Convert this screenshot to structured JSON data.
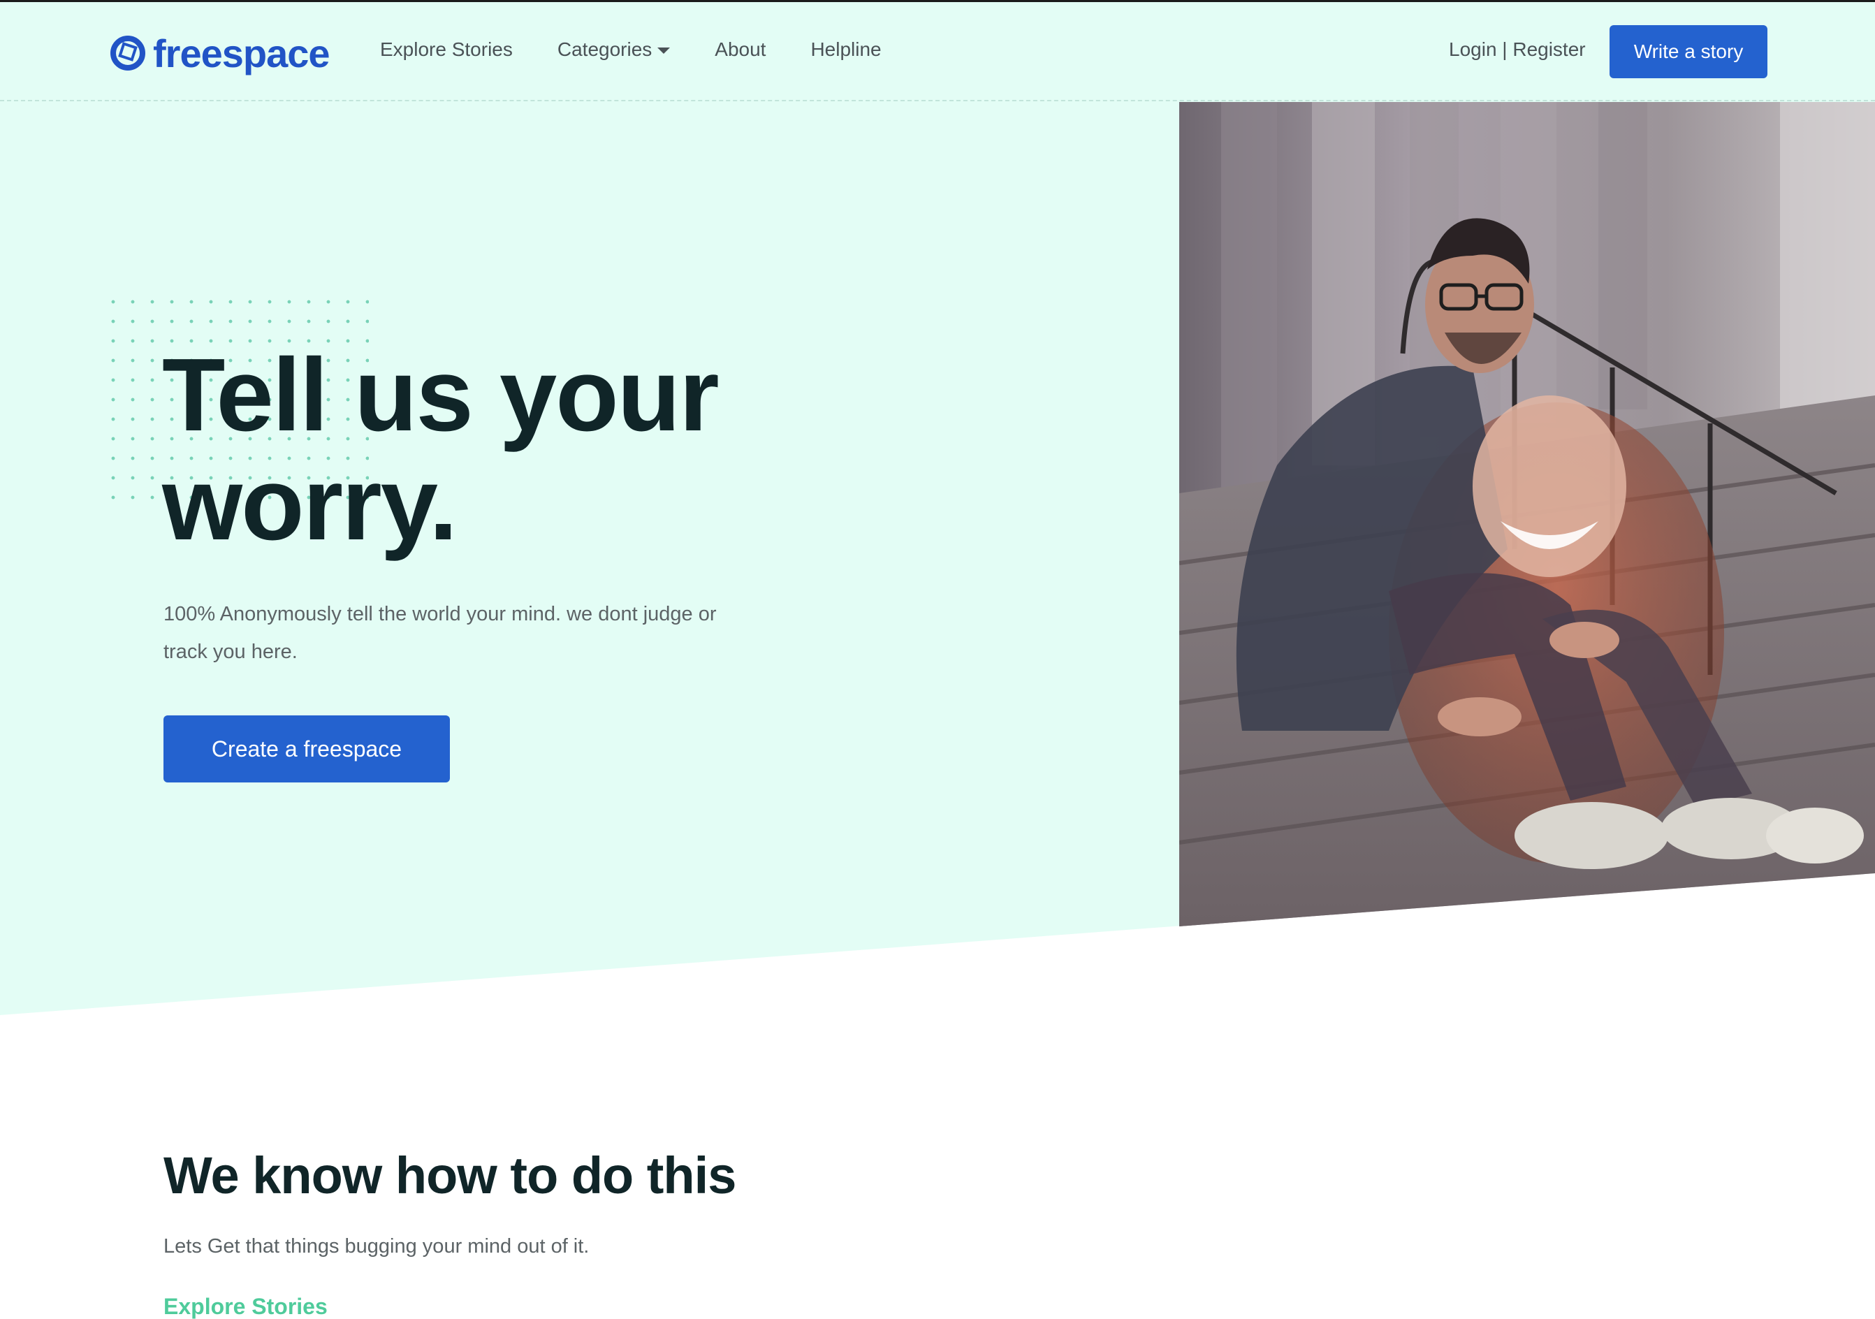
{
  "brand": {
    "name": "freespace",
    "color": "#2154c6"
  },
  "nav": {
    "links": [
      {
        "label": "Explore Stories"
      },
      {
        "label": "Categories"
      },
      {
        "label": "About"
      },
      {
        "label": "Helpline"
      }
    ],
    "auth_label": "Login | Register",
    "write_button": "Write a story"
  },
  "hero": {
    "title_line1": "Tell us your",
    "title_line2": "worry.",
    "subtitle": "100% Anonymously tell the world your mind. we dont judge or track you here.",
    "cta": "Create a freespace",
    "image_icon": "photo-of-people-laughing-on-steps"
  },
  "section": {
    "title": "We know how to do this",
    "subtitle": "Lets Get that things bugging your mind out of it.",
    "link": "Explore Stories"
  },
  "colors": {
    "hero_background": "#e3fdf5",
    "primary": "#2462cf",
    "heading": "#102528",
    "accent_link": "#4fcb9b"
  }
}
